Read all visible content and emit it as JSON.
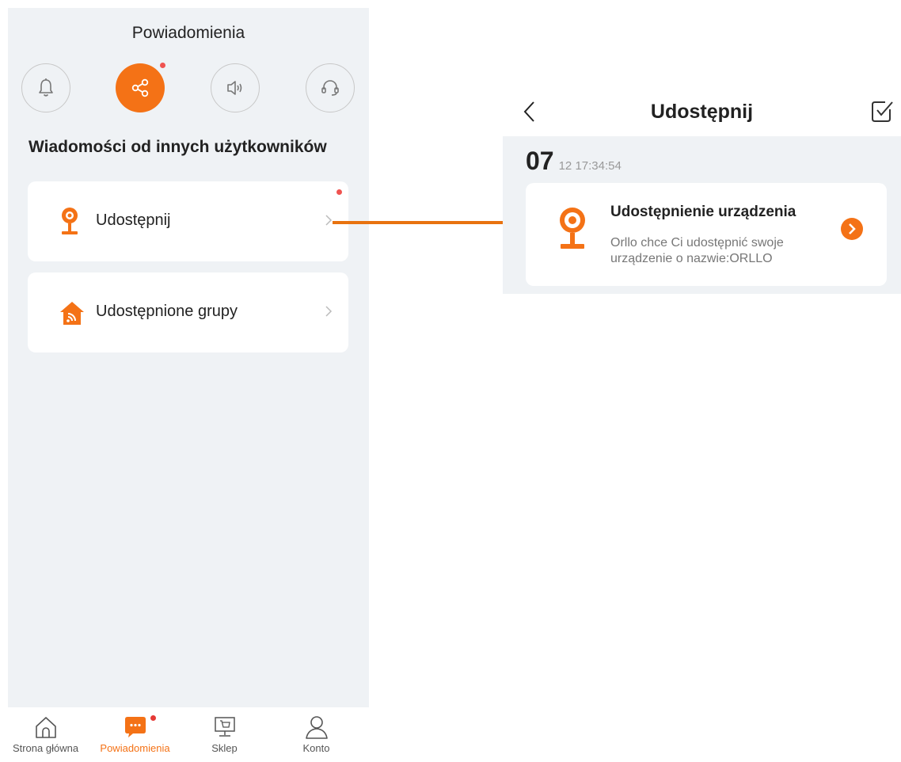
{
  "left": {
    "title": "Powiadomienia",
    "section_heading": "Wiadomości od innych użytkowników",
    "top_icons": [
      {
        "name": "bell-icon",
        "active": false
      },
      {
        "name": "share-icon",
        "active": true,
        "badge": true
      },
      {
        "name": "speaker-icon",
        "active": false
      },
      {
        "name": "headset-icon",
        "active": false
      }
    ],
    "cards": [
      {
        "label": "Udostępnij",
        "icon": "camera-icon",
        "badge": true
      },
      {
        "label": "Udostępnione grupy",
        "icon": "home-wifi-icon",
        "badge": false
      }
    ],
    "nav": [
      {
        "label": "Strona główna",
        "icon": "home-icon",
        "active": false
      },
      {
        "label": "Powiadomienia",
        "icon": "chat-icon",
        "active": true,
        "badge": true
      },
      {
        "label": "Sklep",
        "icon": "shop-icon",
        "active": false
      },
      {
        "label": "Konto",
        "icon": "user-icon",
        "active": false
      }
    ]
  },
  "right": {
    "title": "Udostępnij",
    "date_day": "07",
    "date_time": "12 17:34:54",
    "message": {
      "title": "Udostępnienie urządzenia",
      "text": "Orllo  chce Ci udostępnić swoje urządzenie o nazwie:ORLLO",
      "icon": "camera-icon"
    }
  },
  "colors": {
    "accent": "#f47216",
    "background": "#eff2f5",
    "badge": "#ef5350"
  }
}
